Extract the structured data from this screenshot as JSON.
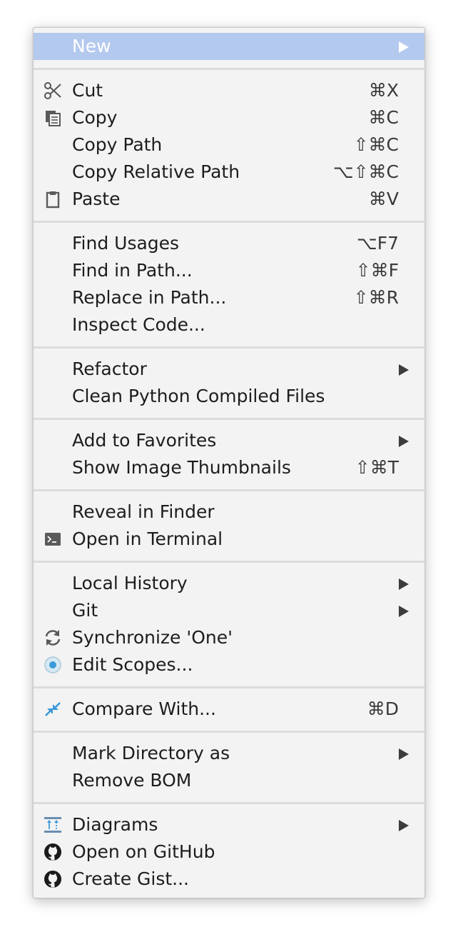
{
  "menu": {
    "new": {
      "label": "New"
    },
    "cut": {
      "label": "Cut",
      "shortcut": "⌘X",
      "icon": "scissors-icon"
    },
    "copy": {
      "label": "Copy",
      "shortcut": "⌘C",
      "icon": "copy-icon"
    },
    "copy_path": {
      "label": "Copy Path",
      "shortcut": "⇧⌘C"
    },
    "copy_relative_path": {
      "label": "Copy Relative Path",
      "shortcut": "⌥⇧⌘C"
    },
    "paste": {
      "label": "Paste",
      "shortcut": "⌘V",
      "icon": "clipboard-icon"
    },
    "find_usages": {
      "label": "Find Usages",
      "shortcut": "⌥F7"
    },
    "find_in_path": {
      "label": "Find in Path...",
      "shortcut": "⇧⌘F"
    },
    "replace_in_path": {
      "label": "Replace in Path...",
      "shortcut": "⇧⌘R"
    },
    "inspect_code": {
      "label": "Inspect Code..."
    },
    "refactor": {
      "label": "Refactor"
    },
    "clean_python": {
      "label": "Clean Python Compiled Files"
    },
    "add_to_favorites": {
      "label": "Add to Favorites"
    },
    "show_image_thumbnails": {
      "label": "Show Image Thumbnails",
      "shortcut": "⇧⌘T"
    },
    "reveal_in_finder": {
      "label": "Reveal in Finder"
    },
    "open_in_terminal": {
      "label": "Open in Terminal",
      "icon": "terminal-icon"
    },
    "local_history": {
      "label": "Local History"
    },
    "git": {
      "label": "Git"
    },
    "synchronize": {
      "label": "Synchronize 'One'",
      "icon": "sync-icon"
    },
    "edit_scopes": {
      "label": "Edit Scopes...",
      "icon": "scope-icon"
    },
    "compare_with": {
      "label": "Compare With...",
      "shortcut": "⌘D",
      "icon": "compare-arrows-icon"
    },
    "mark_directory_as": {
      "label": "Mark Directory as"
    },
    "remove_bom": {
      "label": "Remove BOM"
    },
    "diagrams": {
      "label": "Diagrams",
      "icon": "diagram-icon"
    },
    "open_on_github": {
      "label": "Open on GitHub",
      "icon": "github-icon"
    },
    "create_gist": {
      "label": "Create Gist...",
      "icon": "github-icon"
    }
  },
  "colors": {
    "highlight": "#b4c9ee",
    "menu_background": "#f3f3f3",
    "separator": "#dcdcdc",
    "icon_blue": "#3b9ad9"
  }
}
